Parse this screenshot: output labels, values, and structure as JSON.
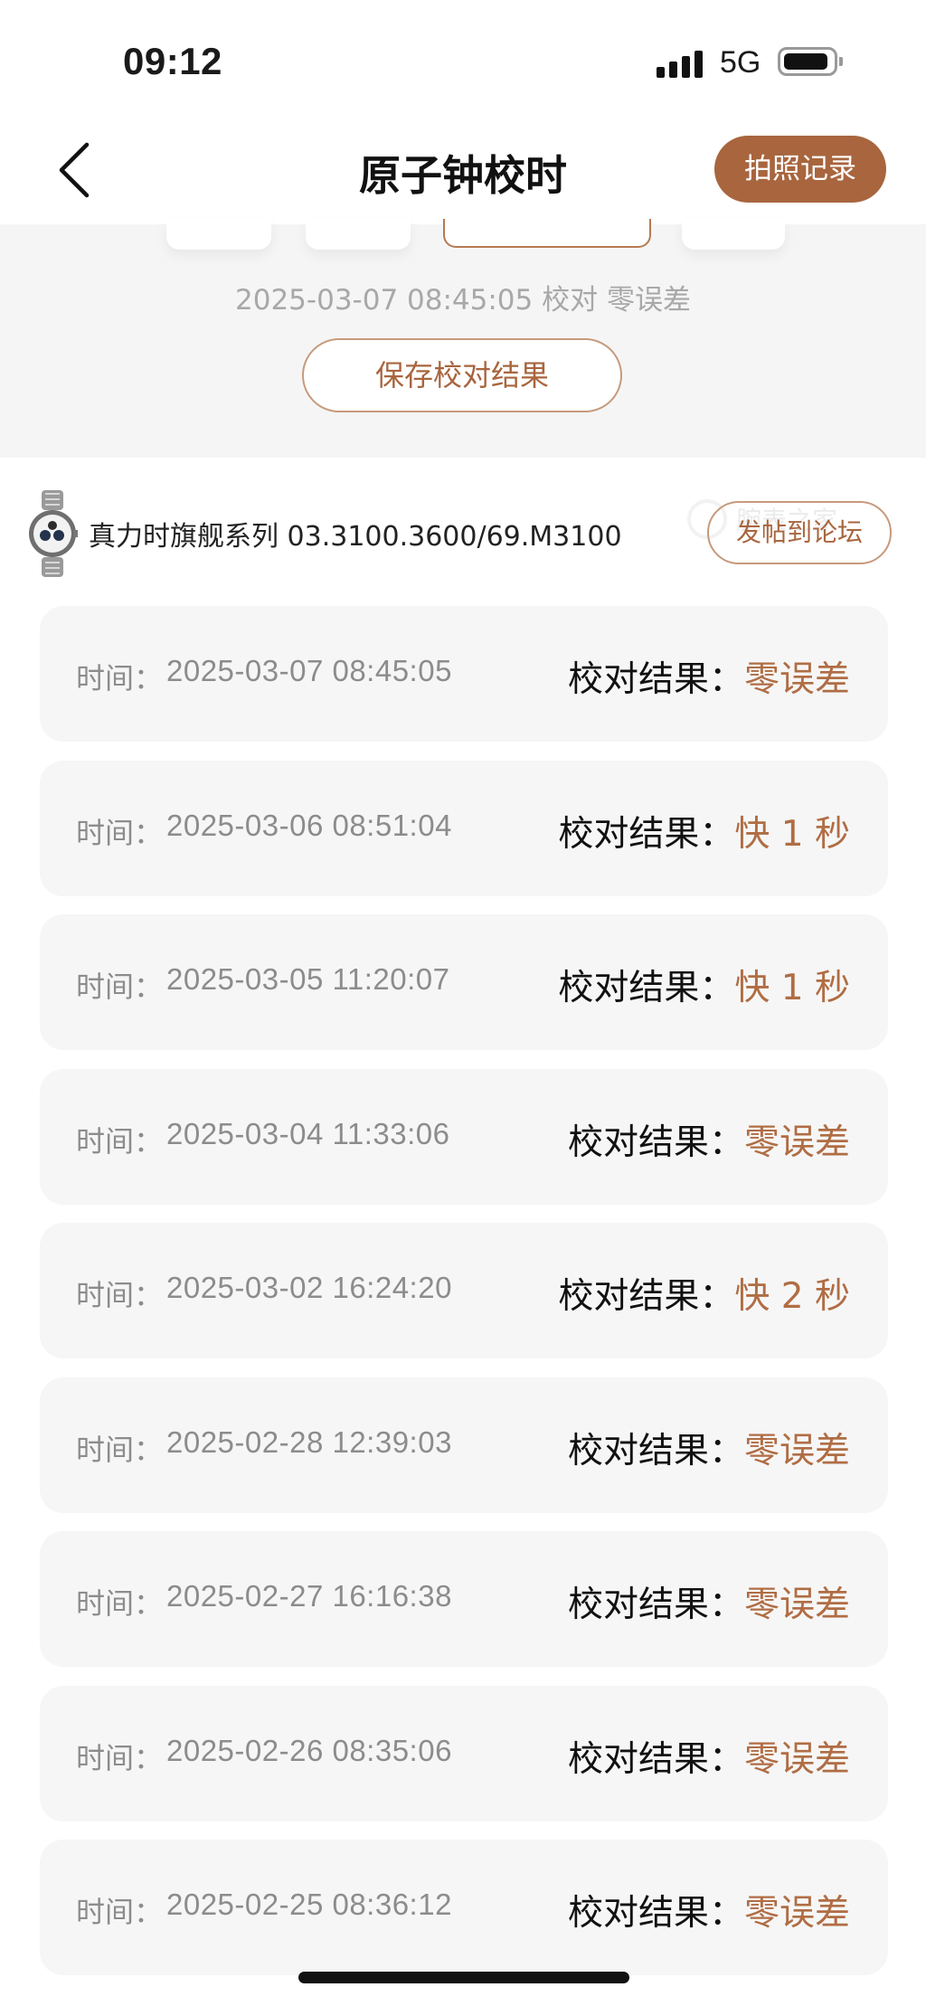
{
  "status_bar": {
    "time": "09:12",
    "network": "5G",
    "icons": [
      "signal-icon",
      "battery-icon"
    ]
  },
  "nav": {
    "title": "原子钟校时",
    "photo_record_label": "拍照记录",
    "back_icon": "chevron-left-icon"
  },
  "summary": {
    "text": "2025-03-07 08:45:05 校对 零误差",
    "save_label": "保存校对结果"
  },
  "watch": {
    "name": "真力时旗舰系列 03.3100.3600/69.M3100",
    "post_label": "发帖到论坛",
    "watermark_text": "腕表之家"
  },
  "colors": {
    "accent": "#a8653e",
    "result_text": "#b06d44",
    "card_bg": "#f6f6f6",
    "panel_bg": "#f5f5f5"
  },
  "records_labels": {
    "time_label": "时间：",
    "result_label": "校对结果："
  },
  "records": [
    {
      "time": "2025-03-07 08:45:05",
      "result": "零误差"
    },
    {
      "time": "2025-03-06 08:51:04",
      "result": "快 1 秒"
    },
    {
      "time": "2025-03-05 11:20:07",
      "result": "快 1 秒"
    },
    {
      "time": "2025-03-04 11:33:06",
      "result": "零误差"
    },
    {
      "time": "2025-03-02 16:24:20",
      "result": "快 2 秒"
    },
    {
      "time": "2025-02-28 12:39:03",
      "result": "零误差"
    },
    {
      "time": "2025-02-27 16:16:38",
      "result": "零误差"
    },
    {
      "time": "2025-02-26 08:35:06",
      "result": "零误差"
    },
    {
      "time": "2025-02-25 08:36:12",
      "result": "零误差"
    }
  ]
}
